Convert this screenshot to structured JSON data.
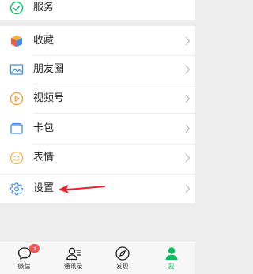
{
  "menu": {
    "services_label": "服务",
    "favorites_label": "收藏",
    "moments_label": "朋友圈",
    "channels_label": "视频号",
    "cards_label": "卡包",
    "stickers_label": "表情",
    "settings_label": "设置"
  },
  "tabbar": {
    "chats_label": "微信",
    "chats_badge": "3",
    "contacts_label": "通讯录",
    "discover_label": "发现",
    "me_label": "我"
  },
  "colors": {
    "background": "#ededed",
    "accent_green": "#07c160",
    "badge_red": "#fa5151",
    "annotation_red": "#e4222b"
  }
}
